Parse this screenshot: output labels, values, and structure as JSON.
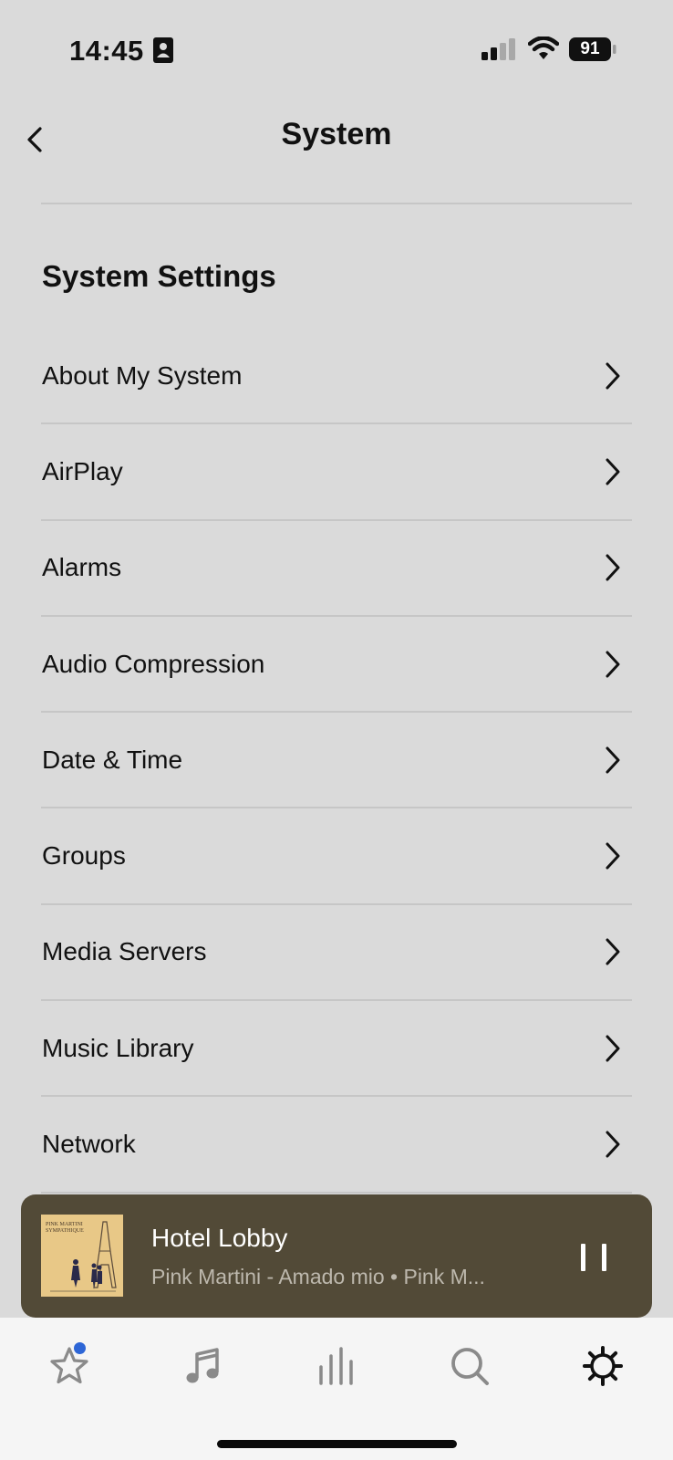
{
  "status_bar": {
    "time": "14:45",
    "battery": "91",
    "icons": [
      "contact-card-icon",
      "cellular-signal-icon",
      "wifi-icon",
      "battery-icon"
    ]
  },
  "header": {
    "title": "System",
    "back_icon": "chevron-left-icon"
  },
  "section": {
    "title": "System Settings"
  },
  "settings": {
    "items": [
      {
        "label": "About My System"
      },
      {
        "label": "AirPlay"
      },
      {
        "label": "Alarms"
      },
      {
        "label": "Audio Compression"
      },
      {
        "label": "Date & Time"
      },
      {
        "label": "Groups"
      },
      {
        "label": "Media Servers"
      },
      {
        "label": "Music Library"
      },
      {
        "label": "Network"
      }
    ]
  },
  "now_playing": {
    "room": "Hotel Lobby",
    "track": "Pink Martini - Amado mio • Pink M...",
    "album_art_text": "PINK MARTINI SYMPATHIQUE",
    "state_icon": "pause-icon",
    "background_color": "#524a37"
  },
  "tabs": [
    {
      "name": "favorites",
      "icon": "star-icon",
      "has_notification": true
    },
    {
      "name": "music",
      "icon": "music-note-icon"
    },
    {
      "name": "rooms",
      "icon": "equalizer-bars-icon"
    },
    {
      "name": "search",
      "icon": "search-icon"
    },
    {
      "name": "settings",
      "icon": "gear-icon",
      "active": true
    }
  ],
  "colors": {
    "background": "#dadada",
    "tab_bar": "#f5f5f5",
    "notification_dot": "#2d66d6",
    "inactive_tab_icon": "#8a8a8a",
    "active_tab_icon": "#111111"
  }
}
